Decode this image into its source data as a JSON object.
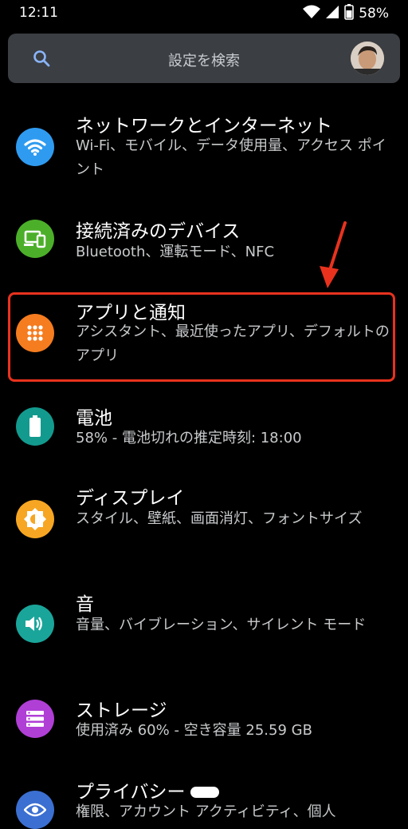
{
  "status_bar": {
    "time": "12:11",
    "battery": "58%",
    "icons": [
      "wifi-icon",
      "signal-icon",
      "battery-icon"
    ]
  },
  "search": {
    "placeholder": "設定を検索",
    "icon": "search-icon",
    "avatar": "user-avatar"
  },
  "items": [
    {
      "title": "ネットワークとインターネット",
      "subtitle": "Wi-Fi、モバイル、データ使用量、アクセス ポイント",
      "icon": "wifi-icon",
      "color": "#2f9bf0"
    },
    {
      "title": "接続済みのデバイス",
      "subtitle": "Bluetooth、運転モード、NFC",
      "icon": "devices-icon",
      "color": "#4caf2a"
    },
    {
      "title": "アプリと通知",
      "subtitle": "アシスタント、最近使ったアプリ、デフォルトのアプリ",
      "icon": "apps-grid-icon",
      "color": "#f57c1f"
    },
    {
      "title": "電池",
      "subtitle": "58% - 電池切れの推定時刻: 18:00",
      "icon": "battery-icon",
      "color": "#139a8e"
    },
    {
      "title": "ディスプレイ",
      "subtitle": "スタイル、壁紙、画面消灯、フォントサイズ",
      "icon": "brightness-icon",
      "color": "#f6a623"
    },
    {
      "title": "音",
      "subtitle": "音量、バイブレーション、サイレント モード",
      "icon": "volume-icon",
      "color": "#1aa59a"
    },
    {
      "title": "ストレージ",
      "subtitle": "使用済み 60% - 空き容量 25.59 GB",
      "icon": "storage-icon",
      "color": "#b03fd6"
    },
    {
      "title": "プライバシー",
      "subtitle": "権限、アカウント アクティビティ、個人",
      "icon": "privacy-eye-icon",
      "color": "#3b6fd1"
    }
  ],
  "colors": {
    "background": "#000000",
    "search_bg": "#3b3e42",
    "highlight": "#e8321e"
  }
}
